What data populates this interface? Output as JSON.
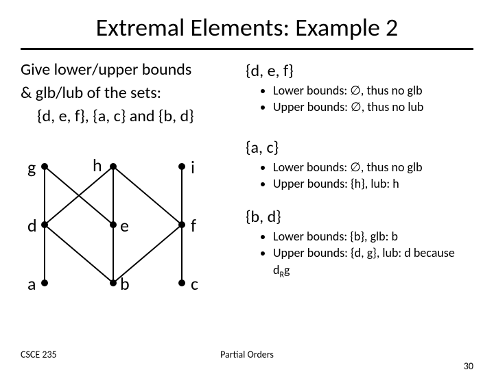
{
  "title": "Extremal Elements: Example 2",
  "prompt_l1": "Give lower/upper bounds",
  "prompt_l2": "& glb/lub of the sets:",
  "prompt_l3": "{d, e, f}, {a, c} and {b, d}",
  "hasse": {
    "g": "g",
    "h": "h",
    "i": "i",
    "d": "d",
    "e": "e",
    "f": "f",
    "a": "a",
    "b": "b",
    "c": "c"
  },
  "set1": {
    "head": "{d, e, f}",
    "b1": "Lower bounds: ∅, thus no glb",
    "b2": "Upper bounds: ∅, thus no lub"
  },
  "set2": {
    "head": "{a, c}",
    "b1": "Lower bounds: ∅, thus no glb",
    "b2_pre": "Upper bounds: {h}, lub: h"
  },
  "set3": {
    "head": "{b, d}",
    "b1": "Lower bounds: {b}, glb: b",
    "b2_pre": "Upper bounds: {d, g}, lub: d because d",
    "b2_sub": "R",
    "b2_post": "g"
  },
  "footer": {
    "left": "CSCE 235",
    "center": "Partial Orders",
    "right": "30"
  }
}
